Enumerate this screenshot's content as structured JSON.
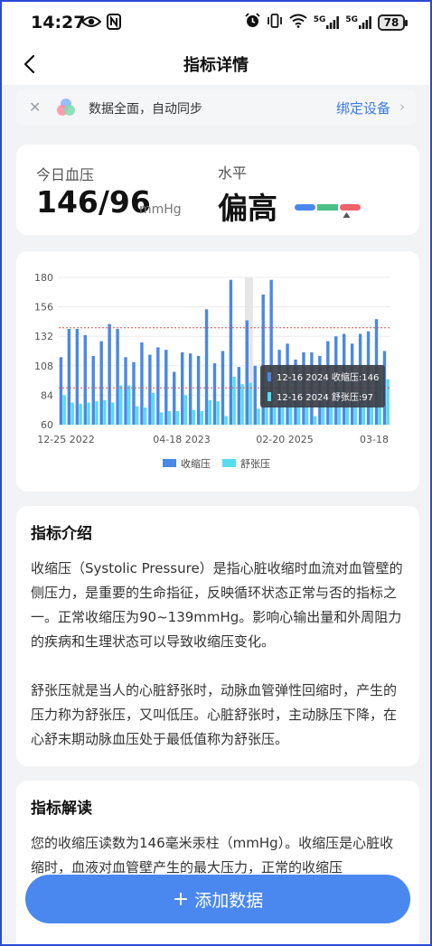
{
  "status_bar": {
    "time": "14:27",
    "network_5g_1": "5G",
    "network_5g_2": "5G",
    "battery": "78"
  },
  "nav": {
    "title": "指标详情"
  },
  "sync_banner": {
    "text": "数据全面，自动同步",
    "link": "绑定设备"
  },
  "today": {
    "label": "今日血压",
    "value": "146/96",
    "unit": "mmHg",
    "level_label": "水平",
    "level_value": "偏高",
    "level_colors": [
      "#4a88f0",
      "#4cbf86",
      "#f0636b"
    ],
    "level_index": 2
  },
  "chart_data": {
    "type": "bar",
    "x_tick_labels": [
      "12-25 2022",
      "04-18 2023",
      "02-20 2025",
      "03-18"
    ],
    "y_ticks": [
      60,
      84,
      108,
      132,
      156,
      180
    ],
    "ylim": [
      60,
      180
    ],
    "reference_lines": [
      139,
      90
    ],
    "reference_color": "#d9534f",
    "grid": true,
    "legend_position": "bottom",
    "series": [
      {
        "name": "收缩压",
        "color": "#4a88e6",
        "values": [
          115,
          138,
          138,
          133,
          116,
          128,
          142,
          138,
          115,
          111,
          127,
          117,
          123,
          121,
          103,
          119,
          118,
          116,
          154,
          110,
          120,
          178,
          107,
          145,
          108,
          166,
          178,
          121,
          126,
          113,
          119,
          119,
          116,
          128,
          132,
          134,
          126,
          134,
          136,
          146,
          120
        ]
      },
      {
        "name": "舒张压",
        "color": "#58dcf0",
        "values": [
          84,
          78,
          77,
          78,
          79,
          80,
          78,
          92,
          92,
          75,
          74,
          86,
          70,
          71,
          71,
          84,
          72,
          71,
          80,
          79,
          67,
          99,
          93,
          94,
          73,
          97,
          76,
          81,
          86,
          82,
          75,
          67,
          83,
          76,
          89,
          82,
          83,
          80,
          79,
          96,
          97
        ]
      }
    ],
    "highlight_index": 23,
    "tooltip": {
      "rows": [
        {
          "date": "12-16 2024",
          "label": "收缩压",
          "value": "146"
        },
        {
          "date": "12-16 2024",
          "label": "舒张压",
          "value": "97"
        }
      ]
    }
  },
  "intro": {
    "title": "指标介绍",
    "paragraphs": [
      "收缩压（Systolic Pressure）是指心脏收缩时血流对血管壁的侧压力，是重要的生命指征，反映循环状态正常与否的指标之一。正常收缩压为90~139mmHg。影响心输出量和外周阻力的疾病和生理状态可以导致收缩压变化。",
      "舒张压就是当人的心脏舒张时，动脉血管弹性回缩时，产生的压力称为舒张压，又叫低压。心脏舒张时，主动脉压下降，在心舒末期动脉血压处于最低值称为舒张压。"
    ]
  },
  "interpretation": {
    "title": "指标解读",
    "text": "您的收缩压读数为146毫米汞柱（mmHg）。收缩压是心脏收缩时，血液对血管壁产生的最大压力，正常的收缩压"
  },
  "add_button": {
    "label": "添加数据",
    "plus": "+"
  }
}
